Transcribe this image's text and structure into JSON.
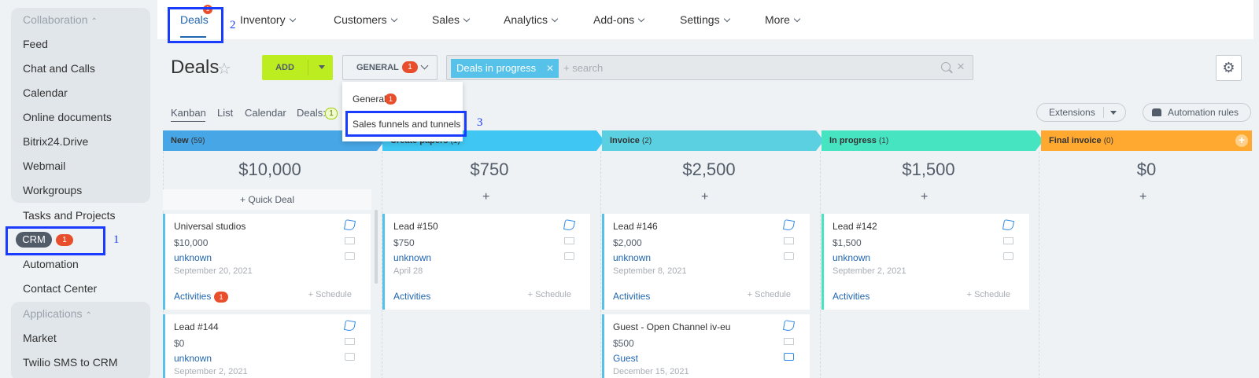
{
  "sidebar": {
    "group1_header": "Collaboration",
    "group2_header": "Applications",
    "items": [
      "Feed",
      "Chat and Calls",
      "Calendar",
      "Online documents",
      "Bitrix24.Drive",
      "Webmail",
      "Workgroups",
      "Tasks and Projects"
    ],
    "crm_label": "CRM",
    "crm_badge": "1",
    "items_after": [
      "Automation",
      "Contact Center"
    ],
    "app_items": [
      "Market",
      "Twilio SMS to CRM"
    ]
  },
  "topnav": {
    "items": [
      "Deals",
      "Inventory",
      "Customers",
      "Sales",
      "Analytics",
      "Add-ons",
      "Settings",
      "More"
    ],
    "deals_badge": "1"
  },
  "toolbar": {
    "title": "Deals",
    "add_label": "ADD",
    "general_label": "GENERAL",
    "general_badge": "1",
    "filter_tag": "Deals in progress",
    "search_placeholder": "+ search"
  },
  "dropdown": {
    "items": [
      "General",
      "Sales funnels and tunnels"
    ],
    "general_badge": "1"
  },
  "views": {
    "tabs": [
      "Kanban",
      "List",
      "Calendar"
    ],
    "deals_label": "Deals:",
    "deals_count": "1",
    "extensions_label": "Extensions",
    "automation_label": "Automation rules"
  },
  "stages": [
    {
      "name": "New",
      "count": "(59)",
      "sum": "$10,000",
      "color": "#47a6e6"
    },
    {
      "name": "Create papers",
      "count": "(1)",
      "sum": "$750",
      "color": "#3fc6f2"
    },
    {
      "name": "Invoice",
      "count": "(2)",
      "sum": "$2,500",
      "color": "#5ad0e0"
    },
    {
      "name": "In progress",
      "count": "(1)",
      "sum": "$1,500",
      "color": "#47e4c2"
    },
    {
      "name": "Final invoice",
      "count": "(0)",
      "sum": "$0",
      "color": "#ffa931"
    }
  ],
  "quick_deal_label": "+ Quick Deal",
  "cards": {
    "c1": {
      "title": "Universal studios",
      "sum": "$10,000",
      "client": "unknown",
      "date": "September 20, 2021",
      "activities": "Activities",
      "act_badge": "1",
      "schedule": "+ Schedule"
    },
    "c2": {
      "title": "Lead #144",
      "sum": "$0",
      "client": "unknown",
      "date": "September 2, 2021"
    },
    "c3": {
      "title": "Lead #150",
      "sum": "$750",
      "client": "unknown",
      "date": "April 28",
      "activities": "Activities",
      "schedule": "+ Schedule"
    },
    "c4": {
      "title": "Lead #146",
      "sum": "$2,000",
      "client": "unknown",
      "date": "September 8, 2021",
      "activities": "Activities",
      "schedule": "+ Schedule"
    },
    "c5": {
      "title": "Guest - Open Channel iv-eu",
      "sum": "$500",
      "client": "Guest",
      "date": "December 15, 2021"
    },
    "c6": {
      "title": "Lead #142",
      "sum": "$1,500",
      "client": "unknown",
      "date": "September 2, 2021",
      "activities": "Activities",
      "schedule": "+ Schedule"
    }
  },
  "annotations": {
    "a1": "1",
    "a2": "2",
    "a3": "3"
  }
}
